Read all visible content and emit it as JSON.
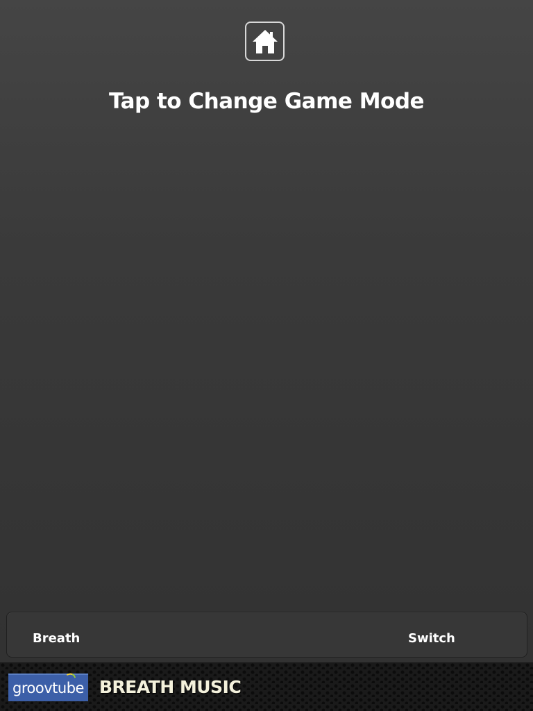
{
  "header": {
    "home_icon": "home-icon",
    "title": "Tap to Change Game Mode"
  },
  "mode_selector": {
    "left_label": "Breath",
    "right_label": "Switch"
  },
  "footer": {
    "logo_text": "groovtube",
    "app_name": "BREATH MUSIC",
    "logo_color": "#3c5fa8"
  }
}
